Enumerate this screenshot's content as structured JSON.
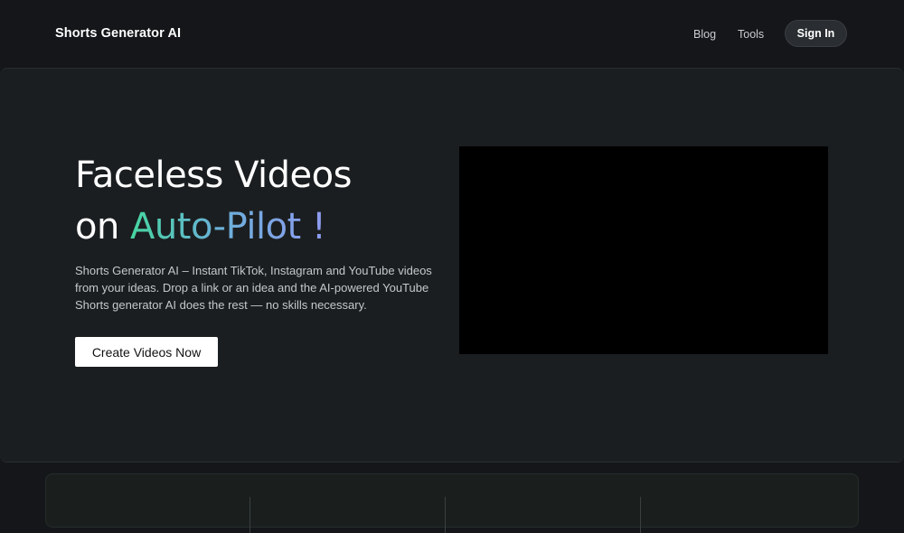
{
  "header": {
    "brand": "Shorts Generator AI",
    "nav": {
      "blog": "Blog",
      "tools": "Tools"
    },
    "signin_label": "Sign In"
  },
  "hero": {
    "headline_line1": "Faceless Videos",
    "headline_prefix": "on ",
    "headline_highlight": "Auto-Pilot !",
    "description": "Shorts Generator  AI – Instant TikTok, Instagram and YouTube videos from your ideas. Drop a link  or an idea and the AI-powered YouTube Shorts generator AI does the rest — no skills necessary.",
    "cta_label": "Create Videos Now"
  },
  "colors": {
    "background": "#141619",
    "hero_background": "#1b1e20",
    "gradient_start": "#46d6a0",
    "gradient_end": "#8f9bf0",
    "cta_background": "#ffffff",
    "video_background": "#000000"
  }
}
